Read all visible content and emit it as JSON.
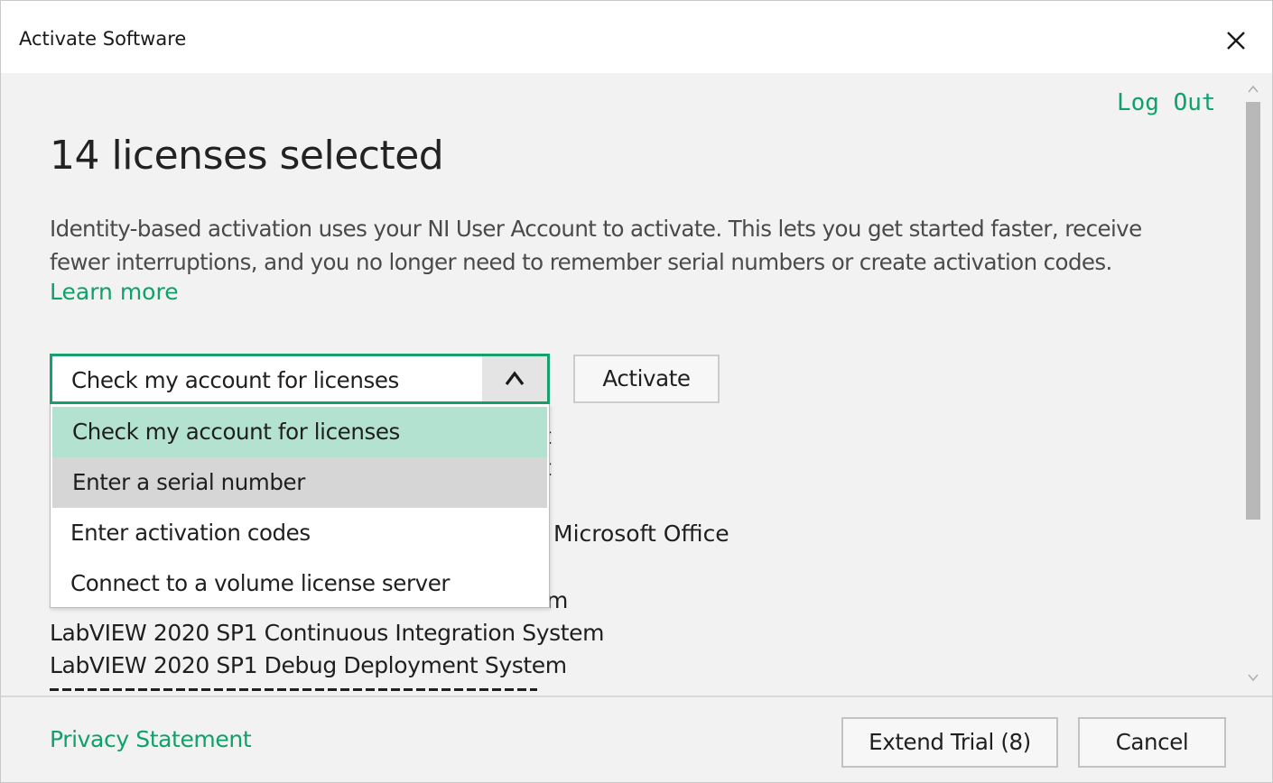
{
  "window": {
    "title": "Activate Software",
    "close_icon": "close-icon"
  },
  "header": {
    "logout_label": "Log Out"
  },
  "main": {
    "title": "14 licenses selected",
    "description_lines": [
      "Identity-based activation uses your NI User Account to activate. This lets you get started faster, receive",
      "fewer interruptions, and you no longer need to remember serial numbers or create activation codes."
    ],
    "learn_more_label": "Learn more"
  },
  "activation": {
    "method_selected": "Check my account for licenses",
    "activate_label": "Activate",
    "options": [
      "Check my account for licenses",
      "Enter a serial number",
      "Enter activation codes",
      "Connect to a volume license server"
    ],
    "selected_index": 0,
    "hover_index": 1
  },
  "license_list": {
    "partial_fragments": [
      "t",
      "t",
      "Microsoft Office",
      "m"
    ],
    "items": [
      "LabVIEW 2020 SP1 Continuous Integration System",
      "LabVIEW 2020 SP1 Debug Deployment System"
    ]
  },
  "footer": {
    "privacy_label": "Privacy Statement",
    "extend_trial_label": "Extend Trial (8)",
    "cancel_label": "Cancel"
  },
  "colors": {
    "accent": "#10a06c",
    "selected_option_bg": "#b3e2d0",
    "hover_option_bg": "#d6d6d6",
    "dialog_bg": "#f2f2f2"
  }
}
